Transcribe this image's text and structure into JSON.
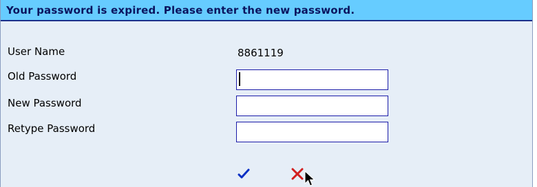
{
  "header": {
    "title": "Your password is expired. Please enter the new password."
  },
  "form": {
    "user_name_label": "User Name",
    "user_name_value": "8861119",
    "old_password_label": "Old Password",
    "new_password_label": "New Password",
    "retype_password_label": "Retype Password",
    "old_password_value": "",
    "new_password_value": "",
    "retype_password_value": ""
  },
  "actions": {
    "ok_icon": "checkmark-icon",
    "cancel_icon": "x-icon"
  },
  "colors": {
    "title_bar_bg": "#66ccff",
    "title_text": "#0b1560",
    "panel_bg": "#e6eef7",
    "input_border": "#1a1aa8",
    "ok_color": "#0a2fc4",
    "cancel_color": "#d21f1f"
  }
}
